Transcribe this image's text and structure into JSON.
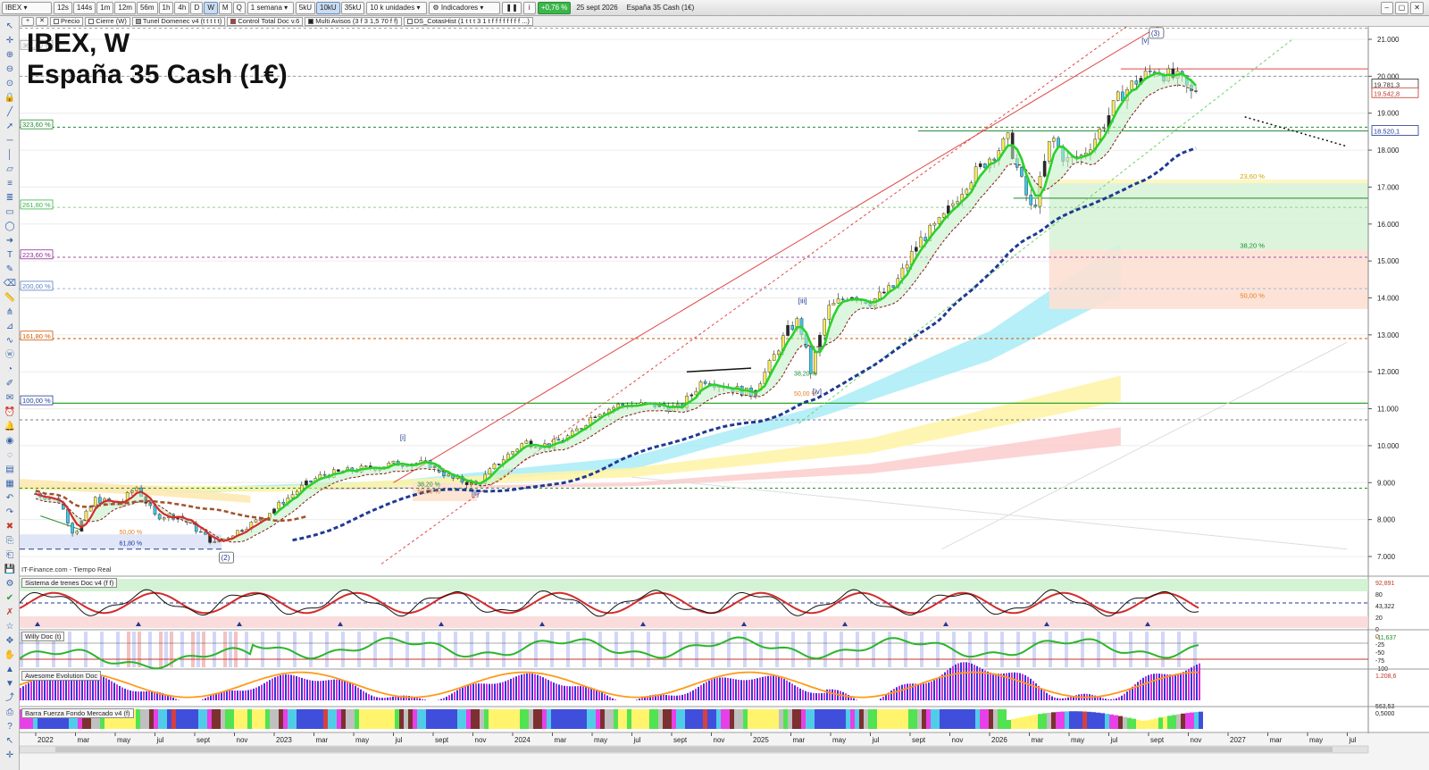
{
  "toolbar": {
    "symbol": "IBEX",
    "timeframes": [
      "12s",
      "144s",
      "1m",
      "12m",
      "56m",
      "1h",
      "4h",
      "D",
      "W",
      "M",
      "Q"
    ],
    "active_timeframe": "W",
    "period": "1 semana",
    "sizes": [
      "5kU",
      "10kU",
      "35kU"
    ],
    "active_size": "10kU",
    "units": "10 k unidades",
    "indicators_label": "Indicadores",
    "change_badge": "+0,76 %",
    "date": "25 sept 2026",
    "instrument": "España 35 Cash (1€)"
  },
  "indicator_tabs": [
    {
      "label": "Precio",
      "color": "#ffffff"
    },
    {
      "label": "Cierre (W)",
      "color": "#ffffff"
    },
    {
      "label": "Tunel Domenec v4 (t t t t t)",
      "color": "#999999"
    },
    {
      "label": "Control Total Doc v.6",
      "color": "#c0392b"
    },
    {
      "label": "Multi Avisos (3 f 3 1,5 70 f f)",
      "color": "#222222"
    },
    {
      "label": "DS_CotasHist (1 t t t 3 1 t f f f f f f f f ...)",
      "color": "#ffffff"
    }
  ],
  "chart": {
    "title": "IBEX, W",
    "subtitle": "España 35 Cash (1€)",
    "source": "IT-Finance.com - Tiempo Real",
    "price_axis": [
      "21.000",
      "20.000",
      "19.000",
      "18.000",
      "17.000",
      "16.000",
      "15.000",
      "14.000",
      "13.000",
      "12.000",
      "11.000",
      "10.000",
      "9.000",
      "8.000",
      "7.000"
    ],
    "price_tags": [
      {
        "label": "19.781,3",
        "color": "#2c2c2c"
      },
      {
        "label": "19.542,8",
        "color": "#c0392b"
      },
      {
        "label": "18.520,1",
        "color": "#1f3a93"
      }
    ],
    "fib_left": [
      {
        "label": "361,80 %",
        "color": "#999999"
      },
      {
        "label": "323,60 %",
        "color": "#1e8b2e"
      },
      {
        "label": "261,80 %",
        "color": "#38b548"
      },
      {
        "label": "223,60 %",
        "color": "#8e2a8e"
      },
      {
        "label": "200,00 %",
        "color": "#5a7fc0"
      },
      {
        "label": "161,80 %",
        "color": "#d35400"
      },
      {
        "label": "100,00 %",
        "color": "#1f3a93"
      }
    ],
    "fib_right": [
      {
        "label": "23,60 %",
        "color": "#c9a800"
      },
      {
        "label": "38,20 %",
        "color": "#1e8b2e"
      },
      {
        "label": "50,00 %",
        "color": "#e67e22"
      }
    ],
    "fib_small": [
      {
        "label": "50,00 %",
        "color": "#e67e22"
      },
      {
        "label": "61,80 %",
        "color": "#1f3a93"
      },
      {
        "label": "38,20 %",
        "color": "#1e8b2e"
      },
      {
        "label": "50,00 %",
        "color": "#e67e22"
      },
      {
        "label": "38,20 %",
        "color": "#1e8b2e"
      },
      {
        "label": "50,00 %",
        "color": "#e67e22"
      }
    ],
    "waves": [
      "(2)",
      "[i]",
      "[ii]",
      "[iii]",
      "[iv]",
      "[v]",
      "(3)"
    ],
    "time_axis": [
      "2022",
      "mar",
      "may",
      "jul",
      "sept",
      "nov",
      "2023",
      "mar",
      "may",
      "jul",
      "sept",
      "nov",
      "2024",
      "mar",
      "may",
      "jul",
      "sept",
      "nov",
      "2025",
      "mar",
      "may",
      "jul",
      "sept",
      "nov",
      "2026",
      "mar",
      "may",
      "jul",
      "sept",
      "nov",
      "2027",
      "mar",
      "may",
      "jul"
    ]
  },
  "panels": [
    {
      "title": "Sistema de trenes Doc v4 (f f)",
      "scale": [
        "92,891",
        "80",
        "43,322",
        "20",
        "0"
      ]
    },
    {
      "title": "Willy Doc (t)",
      "scale": [
        "0",
        "-25",
        "-50",
        "-75",
        "-100"
      ],
      "value": "-11,637"
    },
    {
      "title": "Awesome Evolution Doc",
      "scale": [
        "1.208,6",
        "563,53"
      ]
    },
    {
      "title": "Barra Fuerza Fondo Mercado v4 (f)",
      "scale": [
        "0,5000"
      ]
    }
  ]
}
